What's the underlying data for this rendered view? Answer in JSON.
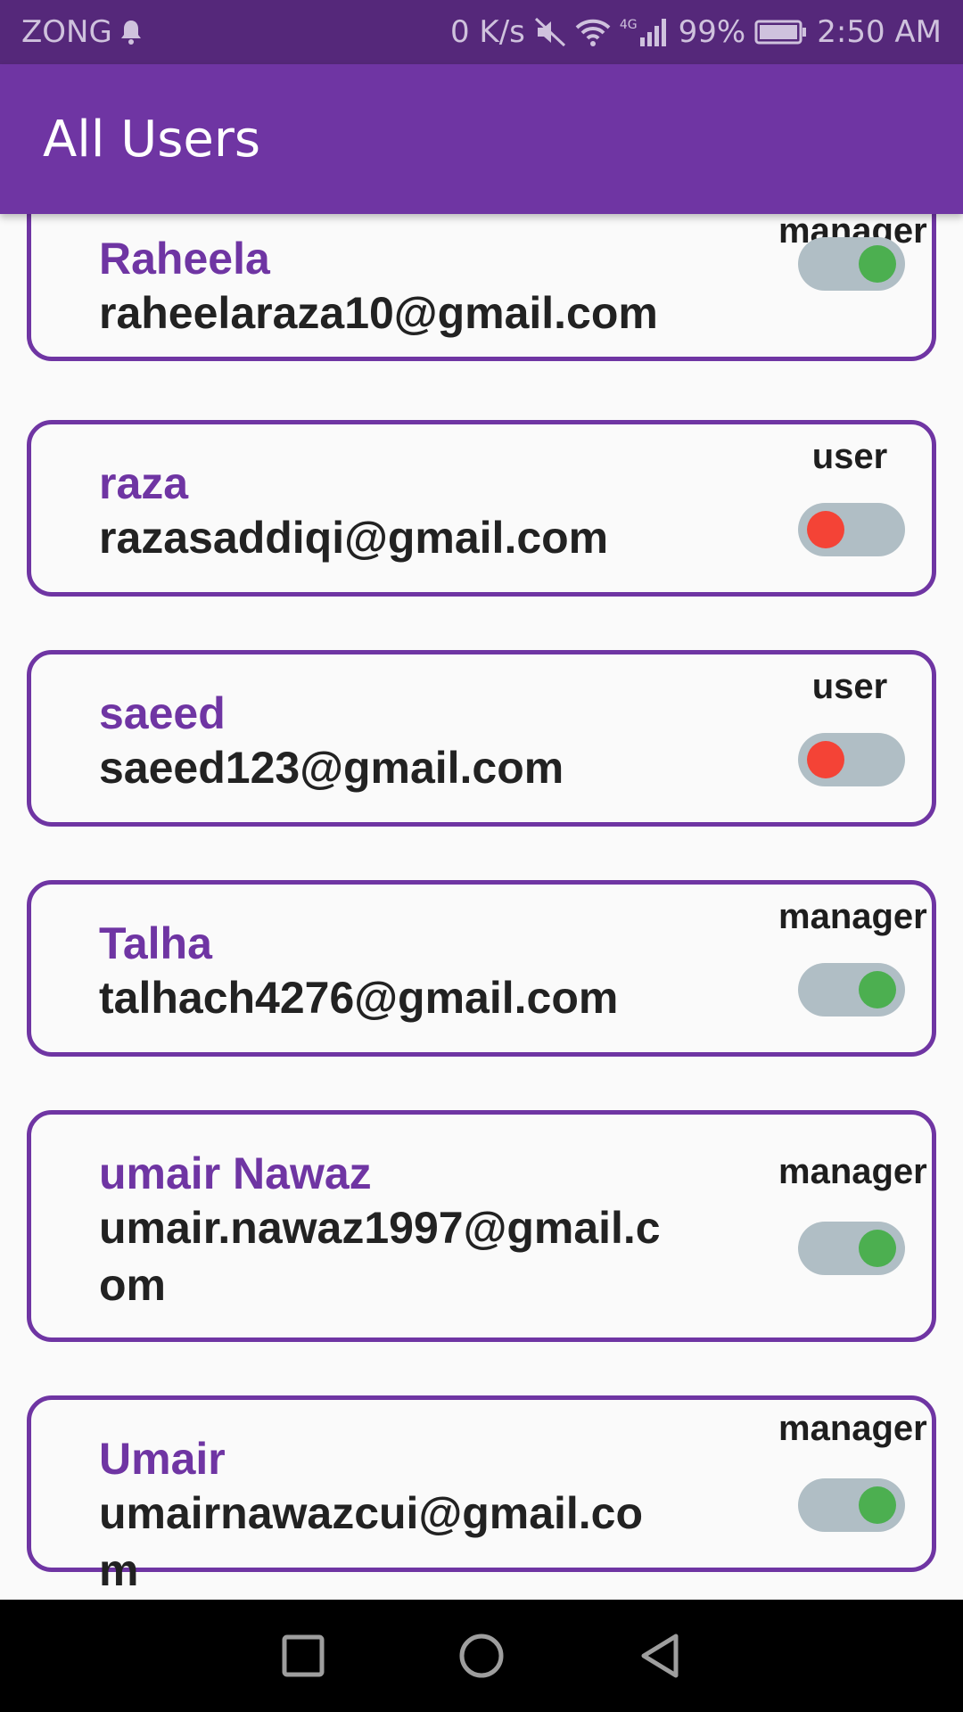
{
  "status_bar": {
    "carrier": "ZONG",
    "speed": "0 K/s",
    "network_type": "4G",
    "battery": "99%",
    "time": "2:50 AM"
  },
  "app_bar": {
    "title": "All Users"
  },
  "users": [
    {
      "name": "Raheela",
      "email": "raheelaraza10@gmail.com",
      "role": "manager",
      "enabled": true
    },
    {
      "name": "raza",
      "email": "razasaddiqi@gmail.com",
      "role": "user",
      "enabled": false
    },
    {
      "name": "saeed",
      "email": "saeed123@gmail.com",
      "role": "user",
      "enabled": false
    },
    {
      "name": "Talha",
      "email": "talhach4276@gmail.com",
      "role": "manager",
      "enabled": true
    },
    {
      "name": "umair Nawaz",
      "email": "umair.nawaz1997@gmail.com",
      "role": "manager",
      "enabled": true
    },
    {
      "name": "Umair",
      "email": "umairnawazcui@gmail.com",
      "role": "manager",
      "enabled": true
    }
  ],
  "colors": {
    "primary": "#6f35a3",
    "status_bar": "#55287a",
    "toggle_on": "#4caf50",
    "toggle_off": "#f44336",
    "toggle_track": "#b0bec5"
  },
  "nav_icons": [
    "recent-apps-icon",
    "home-icon",
    "back-icon"
  ]
}
